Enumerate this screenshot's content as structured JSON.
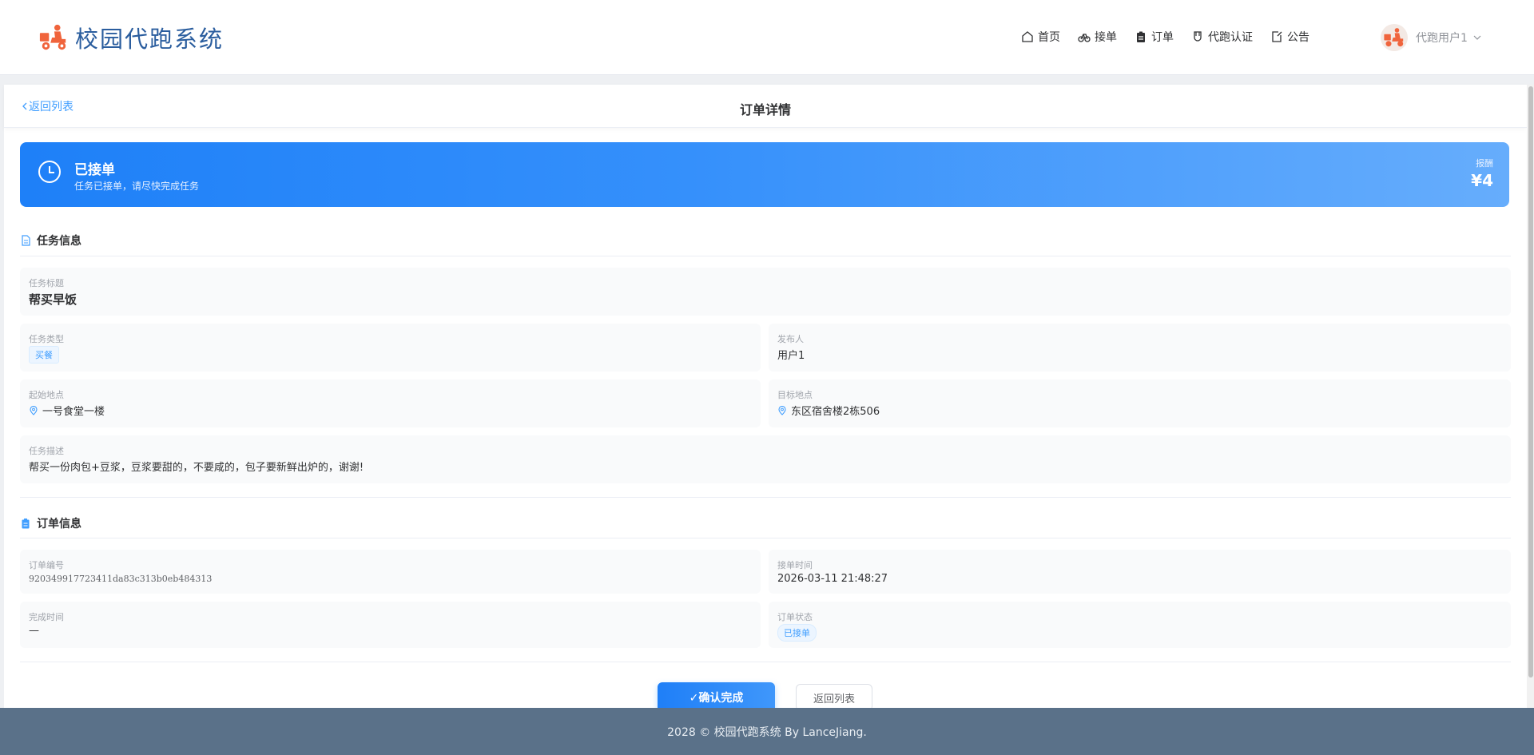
{
  "header": {
    "site_title": "校园代跑系统",
    "nav": [
      {
        "label": "首页",
        "icon": "home-icon"
      },
      {
        "label": "接单",
        "icon": "bike-icon"
      },
      {
        "label": "订单",
        "icon": "clipboard-icon"
      },
      {
        "label": "代跑认证",
        "icon": "badge-icon"
      },
      {
        "label": "公告",
        "icon": "notice-icon"
      }
    ],
    "user_name": "代跑用户1"
  },
  "subheader": {
    "back_label": "返回列表",
    "page_title": "订单详情"
  },
  "banner": {
    "status": "已接单",
    "message": "任务已接单，请尽快完成任务",
    "fee_label": "报酬",
    "fee": "¥4"
  },
  "task_info": {
    "section_title": "任务信息",
    "title_label": "任务标题",
    "title": "帮买早饭",
    "type_label": "任务类型",
    "type": "买餐",
    "publisher_label": "发布人",
    "publisher": "用户1",
    "start_label": "起始地点",
    "start": "一号食堂一楼",
    "target_label": "目标地点",
    "target": "东区宿舍楼2栋506",
    "desc_label": "任务描述",
    "desc": "帮买一份肉包+豆浆，豆浆要甜的，不要咸的，包子要新鲜出炉的，谢谢!"
  },
  "order_info": {
    "section_title": "订单信息",
    "number_label": "订单编号",
    "number": "920349917723411da83c313b0eb484313",
    "accept_time_label": "接单时间",
    "accept_time": "2026-03-11 21:48:27",
    "finish_time_label": "完成时间",
    "finish_time": "—",
    "status_label": "订单状态",
    "status": "已接单"
  },
  "actions": {
    "confirm_label": "✓确认完成",
    "back_label": "返回列表"
  },
  "footer": {
    "text": "2028 © 校园代跑系统 By LanceJiang."
  },
  "colors": {
    "accent": "#409eff",
    "banner_start": "#1e80f8",
    "banner_end": "#66adfc",
    "footer_bg": "#5a7189",
    "logo_text": "#2a5d9e"
  }
}
